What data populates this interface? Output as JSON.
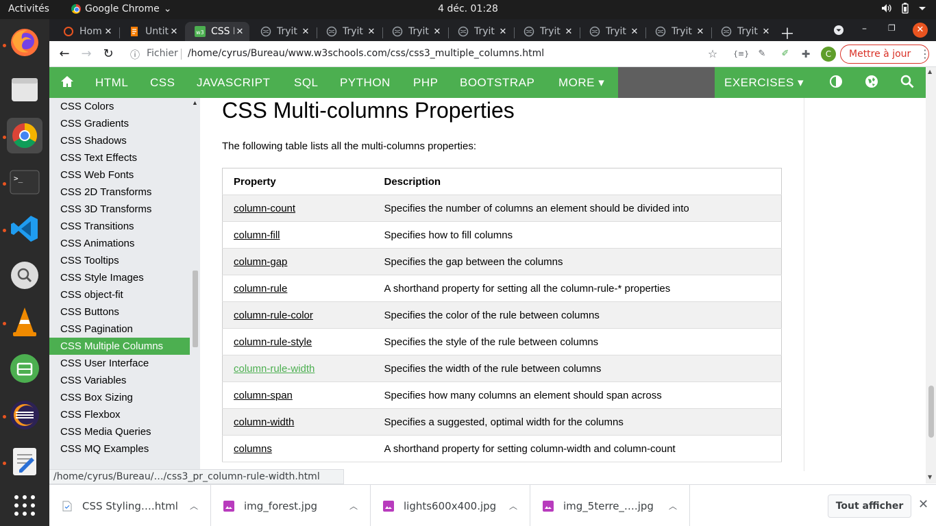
{
  "topbar": {
    "activities": "Activités",
    "app_name": "Google Chrome",
    "clock": "4 déc.  01:28"
  },
  "tabs": [
    {
      "label": "Hom",
      "icon": "ubuntu-icon",
      "active": false
    },
    {
      "label": "Untit",
      "icon": "document-icon",
      "active": false
    },
    {
      "label": "CSS I",
      "icon": "w3schools-icon",
      "active": true
    },
    {
      "label": "Tryit",
      "icon": "globe-icon",
      "active": false
    },
    {
      "label": "Tryit",
      "icon": "globe-icon",
      "active": false
    },
    {
      "label": "Tryit",
      "icon": "globe-icon",
      "active": false
    },
    {
      "label": "Tryit",
      "icon": "globe-icon",
      "active": false
    },
    {
      "label": "Tryit",
      "icon": "globe-icon",
      "active": false
    },
    {
      "label": "Tryit",
      "icon": "globe-icon",
      "active": false
    },
    {
      "label": "Tryit",
      "icon": "globe-icon",
      "active": false
    },
    {
      "label": "Tryit",
      "icon": "globe-icon",
      "active": false
    }
  ],
  "toolbar": {
    "scheme": "Fichier",
    "url": "/home/cyrus/Bureau/www.w3schools.com/css/css3_multiple_columns.html",
    "update_label": "Mettre à jour",
    "avatar_letter": "C"
  },
  "w3nav": {
    "items": [
      "HTML",
      "CSS",
      "JAVASCRIPT",
      "SQL",
      "PYTHON",
      "PHP",
      "BOOTSTRAP",
      "MORE ▾"
    ],
    "exercises": "EXERCISES ▾"
  },
  "sidebar": {
    "items": [
      "CSS Colors",
      "CSS Gradients",
      "CSS Shadows",
      "CSS Text Effects",
      "CSS Web Fonts",
      "CSS 2D Transforms",
      "CSS 3D Transforms",
      "CSS Transitions",
      "CSS Animations",
      "CSS Tooltips",
      "CSS Style Images",
      "CSS object-fit",
      "CSS Buttons",
      "CSS Pagination",
      "CSS Multiple Columns",
      "CSS User Interface",
      "CSS Variables",
      "CSS Box Sizing",
      "CSS Flexbox",
      "CSS Media Queries",
      "CSS MQ Examples"
    ],
    "active_index": 14
  },
  "main": {
    "title": "CSS Multi-columns Properties",
    "intro": "The following table lists all the multi-columns properties:",
    "headers": [
      "Property",
      "Description"
    ],
    "rows": [
      {
        "property": "column-count",
        "description": "Specifies the number of columns an element should be divided into"
      },
      {
        "property": "column-fill",
        "description": "Specifies how to fill columns"
      },
      {
        "property": "column-gap",
        "description": "Specifies the gap between the columns"
      },
      {
        "property": "column-rule",
        "description": "A shorthand property for setting all the column-rule-* properties"
      },
      {
        "property": "column-rule-color",
        "description": "Specifies the color of the rule between columns"
      },
      {
        "property": "column-rule-style",
        "description": "Specifies the style of the rule between columns"
      },
      {
        "property": "column-rule-width",
        "description": "Specifies the width of the rule between columns",
        "hover": true
      },
      {
        "property": "column-span",
        "description": "Specifies how many columns an element should span across"
      },
      {
        "property": "column-width",
        "description": "Specifies a suggested, optimal width for the columns"
      },
      {
        "property": "columns",
        "description": "A shorthand property for setting column-width and column-count"
      }
    ]
  },
  "status_url": "/home/cyrus/Bureau/…/css3_pr_column-rule-width.html",
  "downloads": {
    "items": [
      {
        "name": "CSS Styling….html",
        "icon": "html-file-icon"
      },
      {
        "name": "img_forest.jpg",
        "icon": "image-file-icon"
      },
      {
        "name": "lights600x400.jpg",
        "icon": "image-file-icon"
      },
      {
        "name": "img_5terre_….jpg",
        "icon": "image-file-icon"
      }
    ],
    "show_all": "Tout afficher"
  },
  "colors": {
    "w3_green": "#4caf50",
    "chrome_dark": "#202124",
    "update_red": "#d93025"
  }
}
